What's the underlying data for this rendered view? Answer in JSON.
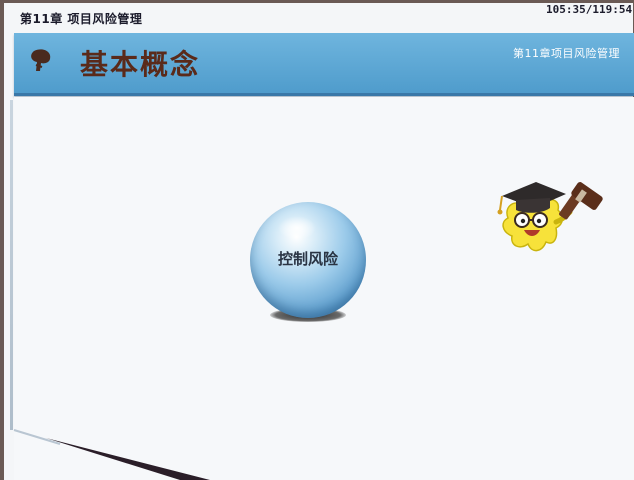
{
  "top_bar": {
    "chapter_label": "第11章 项目风险管理",
    "timer": "105:35/119:54"
  },
  "header": {
    "title": "基本概念",
    "subtitle": "第11章项目风险管理"
  },
  "slide": {
    "sphere_label": "控制风险"
  },
  "colors": {
    "header_blue": "#5aa6d6",
    "title_brown": "#5a2a1a",
    "frame_brown": "#6a5a55"
  },
  "icons": {
    "bullet": "brush-bullet-icon",
    "mascot": "star-professor-gavel-icon"
  }
}
